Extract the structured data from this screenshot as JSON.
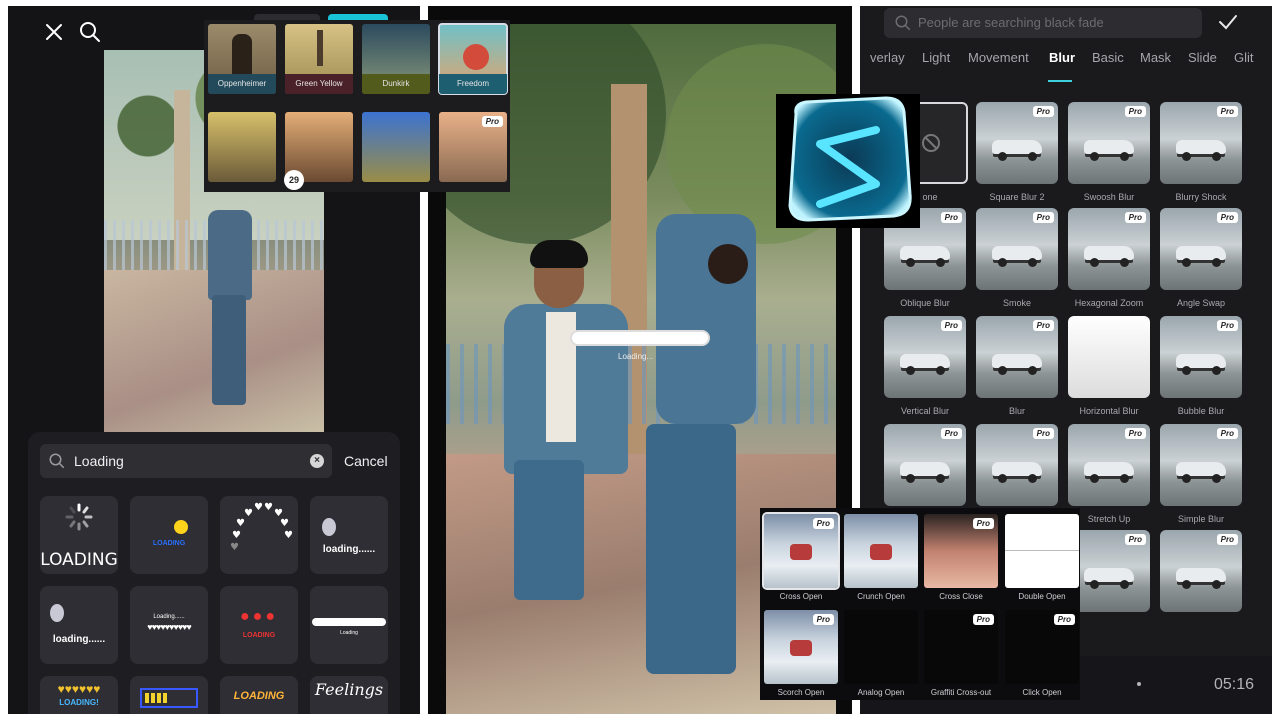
{
  "left_panel": {
    "filters": [
      {
        "label": "Oppenheimer"
      },
      {
        "label": "Green Yellow"
      },
      {
        "label": "Dunkirk"
      },
      {
        "label": "Freedom"
      }
    ],
    "filter_badge_count": "29",
    "pro_label": "Pro",
    "search": {
      "value": "Loading"
    },
    "cancel_label": "Cancel",
    "stickers": [
      {
        "text": "LOADING"
      },
      {
        "text": "LOADING"
      },
      {
        "text": ""
      },
      {
        "text": "loading......"
      },
      {
        "text": "loading......"
      },
      {
        "text": "Loading......"
      },
      {
        "text": "LOADING"
      },
      {
        "text": "Loading"
      },
      {
        "text": "LOADING!"
      },
      {
        "text": ""
      },
      {
        "text": "LOADING"
      },
      {
        "text": "Feelings"
      }
    ]
  },
  "middle_panel": {
    "loading_text": "Loading..."
  },
  "right_panel": {
    "search_placeholder": "People are searching black fade",
    "tabs": [
      "verlay",
      "Light",
      "Movement",
      "Blur",
      "Basic",
      "Mask",
      "Slide",
      "Glit"
    ],
    "active_tab": "Blur",
    "effects": [
      "one",
      "Square Blur 2",
      "Swoosh Blur",
      "Blurry Shock",
      "Oblique Blur",
      "Smoke",
      "Hexagonal Zoom",
      "Angle Swap",
      "Vertical Blur",
      "Blur",
      "Horizontal Blur",
      "Bubble Blur",
      "",
      "",
      "Stretch Up",
      "Simple Blur"
    ],
    "time": "05:16"
  },
  "transitions": [
    "Cross Open",
    "Crunch Open",
    "Cross Close",
    "Double Open",
    "Scorch Open",
    "Analog Open",
    "Graffiti Cross-out",
    "Click Open"
  ],
  "colors": {
    "accent": "#3fd0dd",
    "panel_bg": "#141417"
  }
}
